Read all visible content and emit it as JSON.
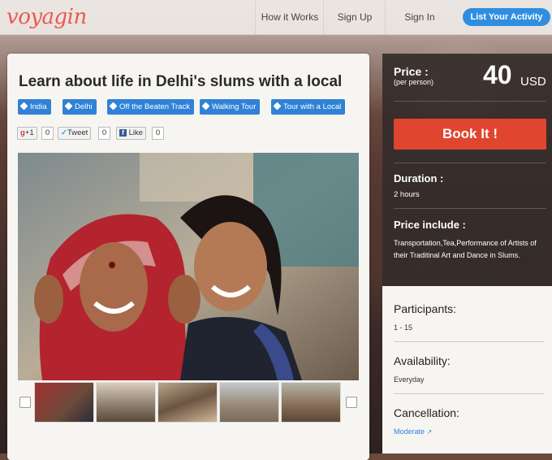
{
  "nav": {
    "logo": "voyagin",
    "links": [
      "How it Works",
      "Sign Up",
      "Sign In"
    ],
    "cta": "List Your Activity"
  },
  "activity": {
    "title": "Learn about life in Delhi's slums with a local",
    "tags": [
      "India",
      "Delhi",
      "Off the Beaten Track",
      "Walking Tour",
      "Tour with a Local"
    ],
    "social": {
      "gplus_label": "+1",
      "gplus_count": "0",
      "tweet_label": "Tweet",
      "tweet_count": "0",
      "like_label": "Like",
      "like_count": "0"
    }
  },
  "booking": {
    "price_label": "Price :",
    "price_sub": "(per person)",
    "price_value": "40",
    "currency": "USD",
    "book_label": "Book It !",
    "duration_label": "Duration :",
    "duration_value": "2 hours",
    "include_label": "Price include :",
    "include_value": "Transportation,Tea,Performance of Artists of their Traditinal Art and Dance in Slums."
  },
  "details": {
    "participants_label": "Participants:",
    "participants_value": "1 - 15",
    "availability_label": "Availability:",
    "availability_value": "Everyday",
    "cancellation_label": "Cancellation:",
    "cancellation_value": "Moderate"
  },
  "colors": {
    "brand": "#e85a4f",
    "accent_blue": "#2f82d6",
    "book_red": "#e0452f"
  },
  "icons": {
    "tag": "tag-icon",
    "external": "external-link-icon"
  }
}
